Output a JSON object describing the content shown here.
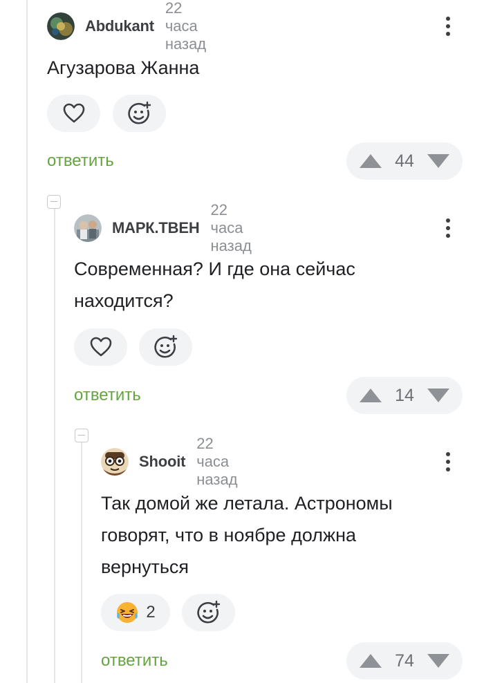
{
  "comments": [
    {
      "username": "Abdukant",
      "time": "22 часа назад",
      "text_lines": [
        "Агузарова Жанна"
      ],
      "reaction_count": "",
      "reply_label": "ответить",
      "score": "44",
      "avatar_color": "#4b6b4d"
    },
    {
      "username": "МАРК.ТВЕН",
      "time": "22 часа назад",
      "text_lines": [
        "Современная? И где она сейчас",
        "находится?"
      ],
      "reaction_count": "",
      "reply_label": "ответить",
      "score": "14",
      "avatar_color": "#9aa4ab"
    },
    {
      "username": "Shooit",
      "time": "22 часа назад",
      "text_lines": [
        "Так домой же летала. Астрономы",
        "говорят, что в ноябре должна",
        "вернуться"
      ],
      "reaction_count": "2",
      "reply_label": "ответить",
      "score": "74",
      "avatar_color": "#c9a46a"
    }
  ],
  "icons": {
    "like": "heart-icon",
    "add_reaction": "add-reaction-icon",
    "upvote": "triangle-up-icon",
    "downvote": "triangle-down-icon",
    "more": "more-vertical-icon",
    "collapse": "collapse-minus-icon",
    "laugh": "laughing-emoji-icon"
  },
  "colors": {
    "reply_green": "#64a53f",
    "pill_bg": "#f2f3f5",
    "thread_line": "#e4e5e6"
  }
}
